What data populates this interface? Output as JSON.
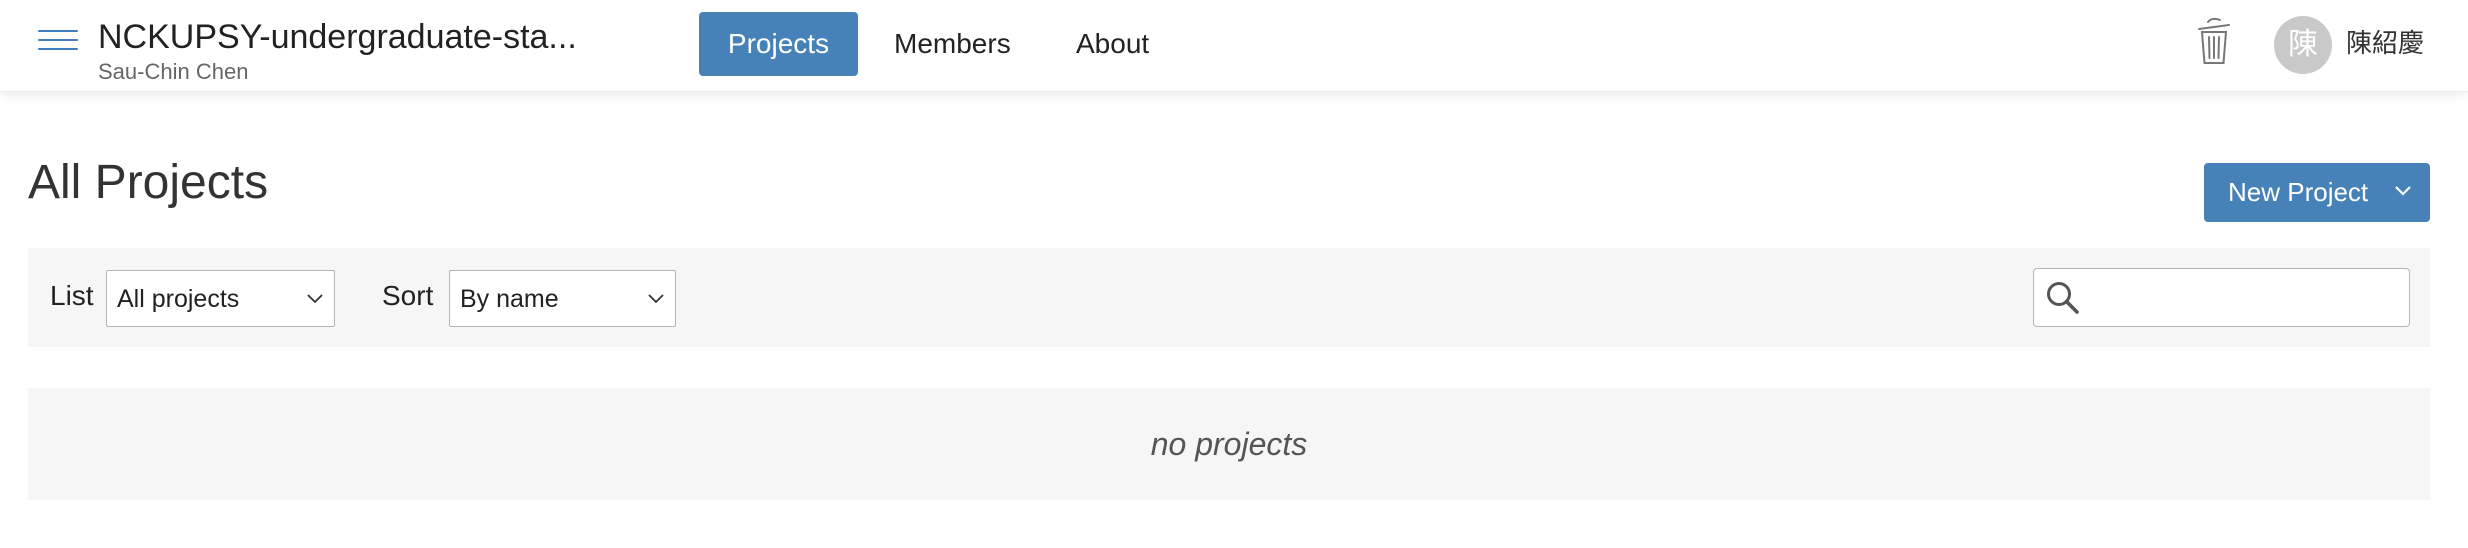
{
  "header": {
    "project_title": "NCKUPSY-undergraduate-sta...",
    "owner": "Sau-Chin Chen",
    "nav": {
      "projects": "Projects",
      "members": "Members",
      "about": "About"
    },
    "user": {
      "avatar_initial": "陳",
      "name": "陳紹慶"
    },
    "icons": {
      "menu": "hamburger-menu-icon",
      "trash": "trash-can-icon"
    }
  },
  "main": {
    "title": "All Projects",
    "new_project_button": "New Project",
    "filters": {
      "list_label": "List",
      "list_value": "All projects",
      "sort_label": "Sort",
      "sort_value": "By name",
      "search_value": ""
    },
    "empty_message": "no projects"
  },
  "colors": {
    "accent": "#4682b8",
    "panel_bg": "#f6f6f6",
    "avatar_bg": "#c9c9c9"
  }
}
